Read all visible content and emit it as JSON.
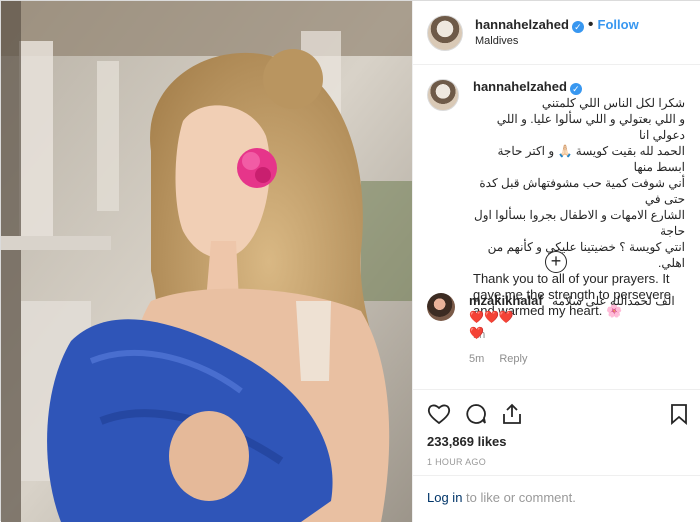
{
  "post": {
    "username": "hannahelzahed",
    "follow_label": "Follow",
    "location": "Maldives",
    "dot": "•"
  },
  "caption": {
    "username": "hannahelzahed",
    "arabic_lines": [
      "شكرا لكل الناس اللي كلمتني",
      "و اللي بعتولي و اللي سألوا عليا. و اللي دعولي انا",
      "الحمد لله بقيت كويسة 🙏🏻 و اكتر حاجة ابسط منها",
      "أني شوفت كمية حب مشوفتهاش قبل كدة حتى في",
      "الشارع الامهات و الاطفال بجروا بسألوا اول حاجة",
      "انتي كويسة ؟ خضيتينا عليكي و كأنهم من اهلي."
    ],
    "english": "Thank you to all of your prayers. It gave me the strength to persevere and warmed my heart. 🌸",
    "time": "1h"
  },
  "comment": {
    "username": "mzakikhalaf",
    "text": "الف لحمدالله على سلامه ❤️❤️❤️",
    "heart": "❤️",
    "time": "5m",
    "reply_label": "Reply"
  },
  "likes": "233,869 likes",
  "posted_ago": "1 HOUR AGO",
  "login": {
    "link": "Log in",
    "rest": " to like or comment."
  }
}
